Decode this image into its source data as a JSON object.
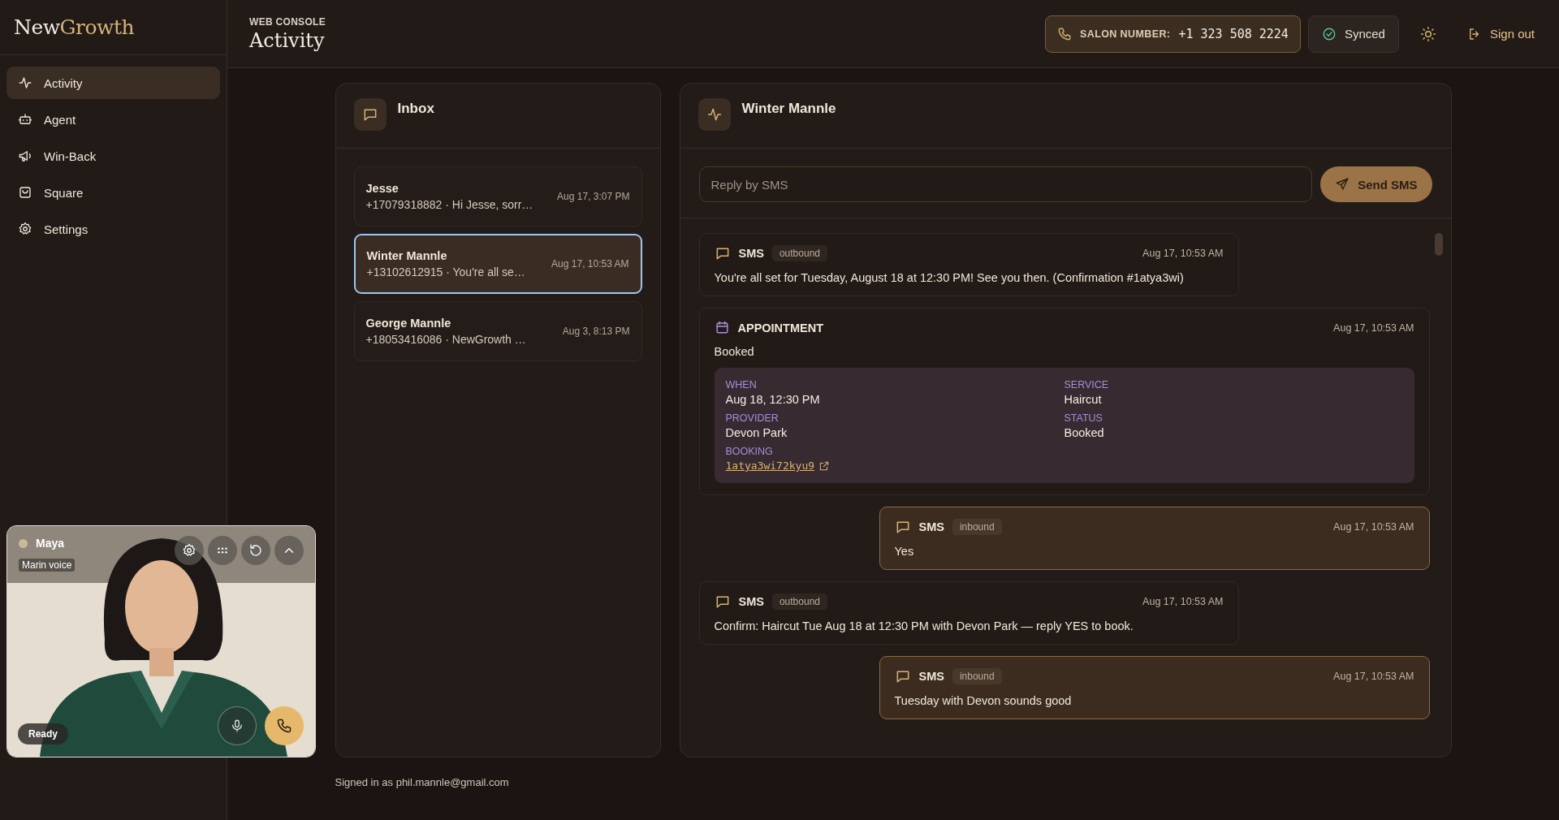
{
  "brand": {
    "first": "New",
    "second": "Growth"
  },
  "nav": [
    {
      "label": "Activity",
      "selected": true
    },
    {
      "label": "Agent",
      "selected": false
    },
    {
      "label": "Win-Back",
      "selected": false
    },
    {
      "label": "Square",
      "selected": false
    },
    {
      "label": "Settings",
      "selected": false
    }
  ],
  "header": {
    "eyebrow": "WEB CONSOLE",
    "title": "Activity"
  },
  "salon": {
    "label": "SALON NUMBER:",
    "number": "+1 323 508 2224"
  },
  "sync": {
    "label": "Synced"
  },
  "sign_out": "Sign out",
  "inbox": {
    "title": "Inbox",
    "conversations": [
      {
        "name": "Jesse",
        "preview": "+17079318882 · Hi Jesse, sorr…",
        "time": "Aug 17, 3:07 PM",
        "selected": false
      },
      {
        "name": "Winter Mannle",
        "preview": "+13102612915 · You're all se…",
        "time": "Aug 17, 10:53 AM",
        "selected": true
      },
      {
        "name": "George Mannle",
        "preview": "+18053416086 · NewGrowth …",
        "time": "Aug 3, 8:13 PM",
        "selected": false
      }
    ]
  },
  "thread": {
    "title": "Winter Mannle",
    "reply": {
      "placeholder": "Reply by SMS"
    },
    "send": "Send SMS",
    "events": [
      {
        "kind": "sms",
        "type": "SMS",
        "direction": "outbound",
        "time": "Aug 17, 10:53 AM",
        "text": "You're all set for Tuesday, August 18 at 12:30 PM! See you then. (Confirmation #1atya3wi)"
      },
      {
        "kind": "appointment",
        "type": "APPOINTMENT",
        "time": "Aug 17, 10:53 AM",
        "text": "Booked",
        "fields": [
          {
            "label": "WHEN",
            "value": "Aug 18, 12:30 PM"
          },
          {
            "label": "SERVICE",
            "value": "Haircut"
          },
          {
            "label": "PROVIDER",
            "value": "Devon Park"
          },
          {
            "label": "STATUS",
            "value": "Booked"
          }
        ],
        "booking": {
          "label": "BOOKING",
          "link": "1atya3wi72kyu9"
        }
      },
      {
        "kind": "sms",
        "type": "SMS",
        "direction": "inbound",
        "time": "Aug 17, 10:53 AM",
        "text": "Yes"
      },
      {
        "kind": "sms",
        "type": "SMS",
        "direction": "outbound",
        "time": "Aug 17, 10:53 AM",
        "text": "Confirm: Haircut Tue Aug 18 at 12:30 PM with Devon Park — reply YES to book."
      },
      {
        "kind": "sms",
        "type": "SMS",
        "direction": "inbound",
        "time": "Aug 17, 10:53 AM",
        "text": "Tuesday with Devon sounds good"
      }
    ]
  },
  "agent": {
    "name": "Maya",
    "voice": "Marin voice",
    "status": "Ready"
  },
  "footer": "Signed in as phil.mannle@gmail.com"
}
